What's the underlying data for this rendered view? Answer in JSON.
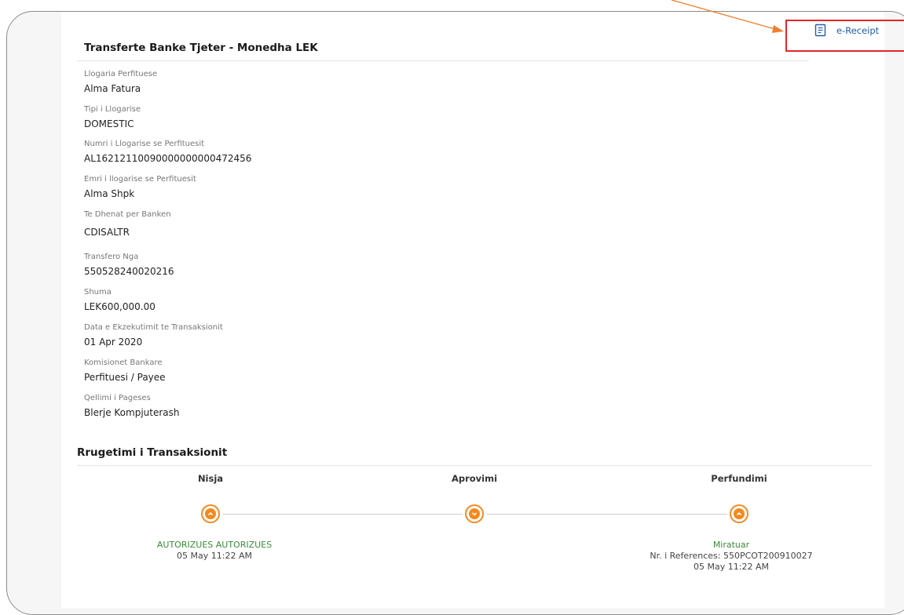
{
  "receipt": {
    "label": "e-Receipt",
    "icon": "document-icon"
  },
  "transfer": {
    "title": "Transferte Banke Tjeter - Monedha LEK",
    "fields": [
      {
        "label": "Llogaria Perfituese",
        "value": "Alma Fatura"
      },
      {
        "label": "Tipi i Llogarise",
        "value": "DOMESTIC"
      },
      {
        "label": "Numri i Llogarise se Perfituesit",
        "value": "AL16212110090000000000472456"
      },
      {
        "label": "Emri i llogarise se Perfituesit",
        "value": "Alma Shpk"
      },
      {
        "label": "Te Dhenat per Banken",
        "value": "CDISALTR"
      },
      {
        "label": "Transfero Nga",
        "value": "550528240020216"
      },
      {
        "label": "Shuma",
        "value": "LEK600,000.00"
      },
      {
        "label": "Data e Ekzekutimit te Transaksionit",
        "value": "01 Apr 2020"
      },
      {
        "label": "Komisionet Bankare",
        "value": "Perfituesi / Payee"
      },
      {
        "label": "Qellimi i Pageses",
        "value": "Blerje Kompjuterash"
      }
    ]
  },
  "routing": {
    "title": "Rrugetimi i Transaksionit",
    "steps": [
      {
        "name": "Nisja",
        "status": "AUTORIZUES AUTORIZUES",
        "lines": [
          "05 May 11:22 AM"
        ]
      },
      {
        "name": "Aprovimi",
        "status": "",
        "lines": []
      },
      {
        "name": "Perfundimi",
        "status": "Miratuar",
        "lines": [
          "Nr. i References: 550PCOT200910027",
          "05 May 11:22 AM"
        ]
      }
    ]
  },
  "colors": {
    "accent": "#f5891f",
    "status_green": "#3a8a3a",
    "link_blue": "#1f5fa8",
    "callout_red": "#e3262b"
  }
}
